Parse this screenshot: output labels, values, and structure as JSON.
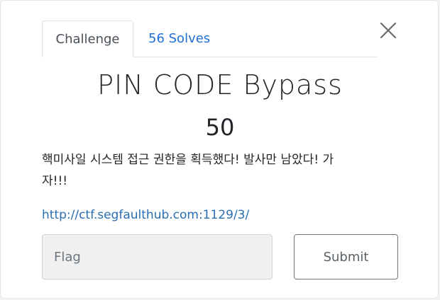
{
  "tabs": {
    "challenge_label": "Challenge",
    "solves_label": "56 Solves"
  },
  "challenge": {
    "title": "PIN CODE Bypass",
    "points": "50",
    "description_line1": "핵미사일 시스템 접근 권한을 획득했다! 발사만 남았다! 가",
    "description_line2": "자!!!",
    "link_text": "http://ctf.segfaulthub.com:1129/3/"
  },
  "form": {
    "flag_placeholder": "Flag",
    "flag_value": "",
    "submit_label": "Submit"
  },
  "icons": {
    "close": "close-icon"
  },
  "colors": {
    "accent_link": "#1e6fd9",
    "input_bg": "#f0f0f0"
  }
}
